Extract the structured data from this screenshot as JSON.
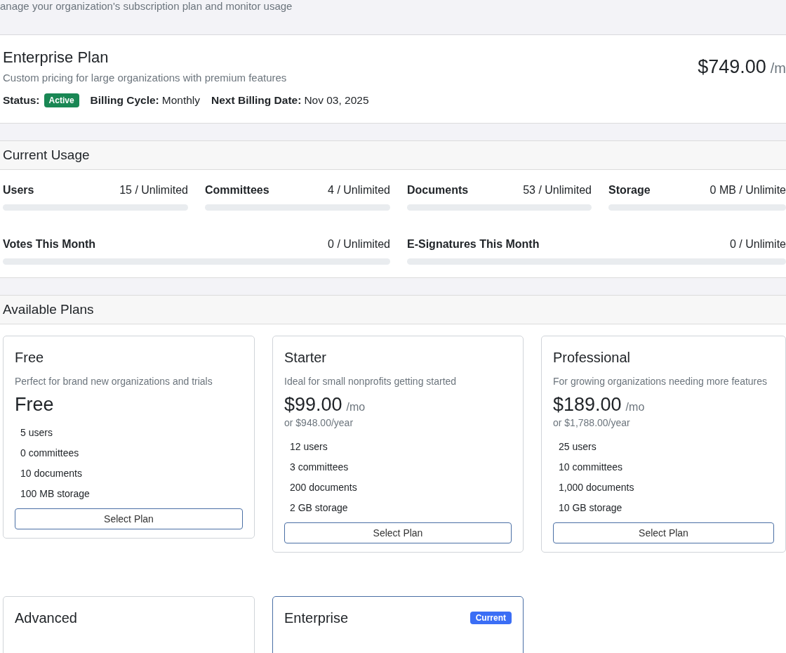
{
  "header": {
    "subtitle": "anage your organization's subscription plan and monitor usage"
  },
  "current_plan": {
    "name": "Enterprise Plan",
    "description": "Custom pricing for large organizations with premium features",
    "status_label": "Status:",
    "status": "Active",
    "billing_cycle_label": "Billing Cycle:",
    "billing_cycle": "Monthly",
    "next_billing_label": "Next Billing Date:",
    "next_billing": "Nov 03, 2025",
    "price": "$749.00",
    "period": "/m"
  },
  "usage": {
    "title": "Current Usage",
    "items": [
      {
        "name": "Users",
        "reading": "15 / Unlimited",
        "level": 0
      },
      {
        "name": "Committees",
        "reading": "4 / Unlimited",
        "level": 0
      },
      {
        "name": "Documents",
        "reading": "53 / Unlimited",
        "level": 0
      },
      {
        "name": "Storage",
        "reading": "0 MB / Unlimite",
        "level": 0
      },
      {
        "name": "Votes This Month",
        "reading": "0 / Unlimited",
        "level": 0
      },
      {
        "name": "E-Signatures This Month",
        "reading": "0 / Unlimite",
        "level": 0
      }
    ]
  },
  "plans": {
    "title": "Available Plans",
    "items": [
      {
        "name": "Free",
        "current": false,
        "description": "Perfect for brand new organizations and trials",
        "price": "Free",
        "features": [
          "5 users",
          "0 committees",
          "10 documents",
          "100 MB storage"
        ],
        "button": "Select Plan"
      },
      {
        "name": "Starter",
        "current": false,
        "description": "Ideal for small nonprofits getting started",
        "price": "$99.00",
        "period": "/mo",
        "yearly": "or $948.00/year",
        "features": [
          "12 users",
          "3 committees",
          "200 documents",
          "2 GB storage"
        ],
        "button": "Select Plan"
      },
      {
        "name": "Professional",
        "current": false,
        "description": "For growing organizations needing more features",
        "price": "$189.00",
        "period": "/mo",
        "yearly": "or $1,788.00/year",
        "features": [
          "25 users",
          "10 committees",
          "1,000 documents",
          "10 GB storage"
        ],
        "button": "Select Plan"
      },
      {
        "name": "Advanced",
        "current": false
      },
      {
        "name": "Enterprise",
        "current": true,
        "badge": "Current"
      }
    ]
  }
}
